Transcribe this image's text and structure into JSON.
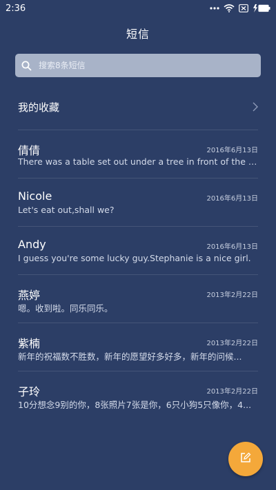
{
  "status_bar": {
    "time": "2:36",
    "icons": [
      "more-dots-icon",
      "wifi-icon",
      "sim-icon",
      "battery-charging-icon"
    ]
  },
  "header": {
    "title": "短信"
  },
  "search": {
    "placeholder": "搜索8条短信",
    "icon": "search-icon"
  },
  "favorites": {
    "label": "我的收藏",
    "icon": "chevron-right-icon"
  },
  "messages": [
    {
      "name": "倩倩",
      "date": "2016年6月13日",
      "preview": "There was a table set out under a tree in front of the ho..."
    },
    {
      "name": "Nicole",
      "date": "2016年6月13日",
      "preview": "Let's eat out,shall we?"
    },
    {
      "name": "Andy",
      "date": "2016年6月13日",
      "preview": "I guess you're some lucky guy.Stephanie is a nice girl."
    },
    {
      "name": "燕婷",
      "date": "2013年2月22日",
      "preview": "嗯。收到啦。同乐同乐。"
    },
    {
      "name": "紫楠",
      "date": "2013年2月22日",
      "preview": "新年的祝福数不胜数，新年的愿望好多好多，新年的问候..."
    },
    {
      "name": "子玲",
      "date": "2013年2月22日",
      "preview": "10分想念9别的你，8张照片7张是你，6只小狗5只像你，4..."
    }
  ],
  "fab": {
    "icon": "compose-icon",
    "color": "#f4a83a"
  },
  "colors": {
    "background": "#2c3e66",
    "search_bg": "#a8b3c8",
    "accent": "#f4a83a"
  }
}
